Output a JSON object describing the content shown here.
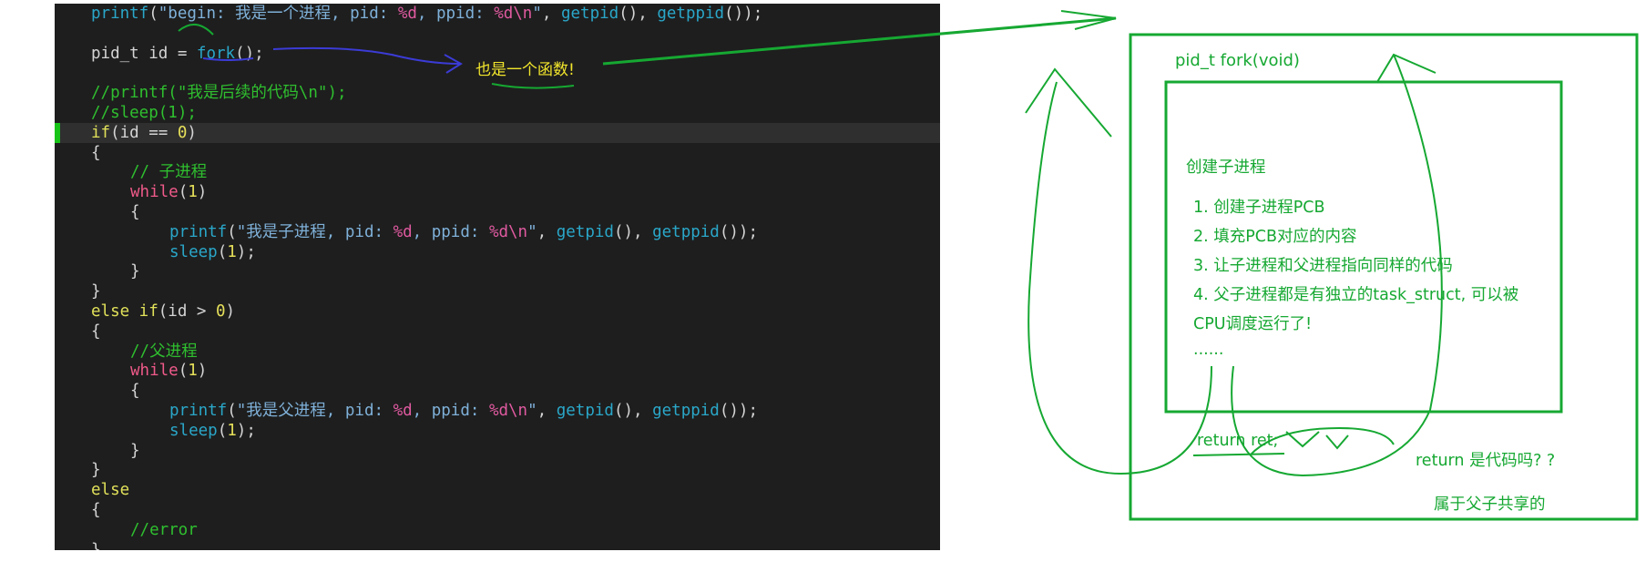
{
  "code": {
    "lines": [
      {
        "indent": 1,
        "tokens": [
          [
            "fn",
            "printf"
          ],
          [
            "pl",
            "("
          ],
          [
            "str",
            "\"begin: 我是一个进程, pid: "
          ],
          [
            "fmt",
            "%d"
          ],
          [
            "str",
            ", ppid: "
          ],
          [
            "fmt",
            "%d\\n"
          ],
          [
            "str",
            "\""
          ],
          [
            "pl",
            ", "
          ],
          [
            "fn",
            "getpid"
          ],
          [
            "pl",
            "(), "
          ],
          [
            "fn",
            "getppid"
          ],
          [
            "pl",
            "());"
          ]
        ]
      },
      {
        "indent": 0,
        "tokens": []
      },
      {
        "indent": 1,
        "tokens": [
          [
            "pl",
            "pid_t id = "
          ],
          [
            "fn",
            "fork"
          ],
          [
            "pl",
            "();"
          ]
        ]
      },
      {
        "indent": 0,
        "tokens": []
      },
      {
        "indent": 1,
        "tokens": [
          [
            "cm",
            "//printf(\"我是后续的代码\\n\");"
          ]
        ]
      },
      {
        "indent": 1,
        "tokens": [
          [
            "cm",
            "//sleep(1);"
          ]
        ]
      },
      {
        "indent": 1,
        "current": true,
        "tokens": [
          [
            "kw",
            "if"
          ],
          [
            "pl",
            "(id == "
          ],
          [
            "num",
            "0"
          ],
          [
            "pl",
            ")"
          ]
        ]
      },
      {
        "indent": 1,
        "tokens": [
          [
            "pl",
            "{"
          ]
        ]
      },
      {
        "indent": 2,
        "tokens": [
          [
            "cm",
            "// 子进程"
          ]
        ]
      },
      {
        "indent": 2,
        "tokens": [
          [
            "loop",
            "while"
          ],
          [
            "pl",
            "("
          ],
          [
            "num",
            "1"
          ],
          [
            "pl",
            ")"
          ]
        ]
      },
      {
        "indent": 2,
        "tokens": [
          [
            "pl",
            "{"
          ]
        ]
      },
      {
        "indent": 3,
        "tokens": [
          [
            "fn",
            "printf"
          ],
          [
            "pl",
            "("
          ],
          [
            "str",
            "\"我是子进程, pid: "
          ],
          [
            "fmt",
            "%d"
          ],
          [
            "str",
            ", ppid: "
          ],
          [
            "fmt",
            "%d\\n"
          ],
          [
            "str",
            "\""
          ],
          [
            "pl",
            ", "
          ],
          [
            "fn",
            "getpid"
          ],
          [
            "pl",
            "(), "
          ],
          [
            "fn",
            "getppid"
          ],
          [
            "pl",
            "());"
          ]
        ]
      },
      {
        "indent": 3,
        "tokens": [
          [
            "fn",
            "sleep"
          ],
          [
            "pl",
            "("
          ],
          [
            "num",
            "1"
          ],
          [
            "pl",
            ");"
          ]
        ]
      },
      {
        "indent": 2,
        "tokens": [
          [
            "pl",
            "}"
          ]
        ]
      },
      {
        "indent": 1,
        "tokens": [
          [
            "pl",
            "}"
          ]
        ]
      },
      {
        "indent": 1,
        "tokens": [
          [
            "kw",
            "else if"
          ],
          [
            "pl",
            "(id > "
          ],
          [
            "num",
            "0"
          ],
          [
            "pl",
            ")"
          ]
        ]
      },
      {
        "indent": 1,
        "tokens": [
          [
            "pl",
            "{"
          ]
        ]
      },
      {
        "indent": 2,
        "tokens": [
          [
            "cm",
            "//父进程"
          ]
        ]
      },
      {
        "indent": 2,
        "tokens": [
          [
            "loop",
            "while"
          ],
          [
            "pl",
            "("
          ],
          [
            "num",
            "1"
          ],
          [
            "pl",
            ")"
          ]
        ]
      },
      {
        "indent": 2,
        "tokens": [
          [
            "pl",
            "{"
          ]
        ]
      },
      {
        "indent": 3,
        "tokens": [
          [
            "fn",
            "printf"
          ],
          [
            "pl",
            "("
          ],
          [
            "str",
            "\"我是父进程, pid: "
          ],
          [
            "fmt",
            "%d"
          ],
          [
            "str",
            ", ppid: "
          ],
          [
            "fmt",
            "%d\\n"
          ],
          [
            "str",
            "\""
          ],
          [
            "pl",
            ", "
          ],
          [
            "fn",
            "getpid"
          ],
          [
            "pl",
            "(), "
          ],
          [
            "fn",
            "getppid"
          ],
          [
            "pl",
            "());"
          ]
        ]
      },
      {
        "indent": 3,
        "tokens": [
          [
            "fn",
            "sleep"
          ],
          [
            "pl",
            "("
          ],
          [
            "num",
            "1"
          ],
          [
            "pl",
            ");"
          ]
        ]
      },
      {
        "indent": 2,
        "tokens": [
          [
            "pl",
            "}"
          ]
        ]
      },
      {
        "indent": 1,
        "tokens": [
          [
            "pl",
            "}"
          ]
        ]
      },
      {
        "indent": 1,
        "tokens": [
          [
            "kw",
            "else"
          ]
        ]
      },
      {
        "indent": 1,
        "tokens": [
          [
            "pl",
            "{"
          ]
        ]
      },
      {
        "indent": 2,
        "tokens": [
          [
            "cm",
            "//error"
          ]
        ]
      },
      {
        "indent": 1,
        "tokens": [
          [
            "pl",
            "}"
          ]
        ]
      }
    ]
  },
  "annotations": {
    "fork_is_function": "也是一个函数!",
    "box_title": "pid_t fork(void)",
    "inner_heading": "创建子进程",
    "steps": [
      "1. 创建子进程PCB",
      "2. 填充PCB对应的内容",
      "3. 让子进程和父进程指向同样的代码",
      "4. 父子进程都是有独立的task_struct, 可以被",
      "CPU调度运行了!",
      "......"
    ],
    "return_line": "return ret;",
    "return_question": "return 是代码吗? ?",
    "shared_note": "属于父子共享的"
  },
  "colors": {
    "editor_bg": "#1e1e1e",
    "annotation_green": "#16a832",
    "annotation_yellow": "#f2e62c",
    "annotation_blue": "#3b3bd6"
  }
}
